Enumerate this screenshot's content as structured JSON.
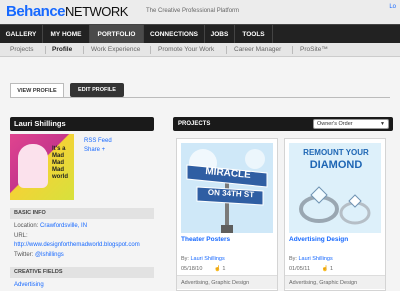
{
  "header": {
    "logo": "Behance",
    "logo_network": "NETWORK",
    "tagline": "The Creative Professional Platform",
    "top_right": "Lo"
  },
  "main_nav": [
    {
      "label": "GALLERY"
    },
    {
      "label": "MY HOME"
    },
    {
      "label": "PORTFOLIO"
    },
    {
      "label": "CONNECTIONS"
    },
    {
      "label": "JOBS"
    },
    {
      "label": "TOOLS"
    }
  ],
  "sub_nav": [
    {
      "label": "Projects"
    },
    {
      "label": "Profile"
    },
    {
      "label": "Work Experience"
    },
    {
      "label": "Promote Your Work"
    },
    {
      "label": "Career Manager"
    },
    {
      "label": "ProSite™"
    }
  ],
  "profile_tabs": {
    "view": "VIEW PROFILE",
    "edit": "EDIT PROFILE"
  },
  "profile": {
    "name": "Lauri Shillings",
    "avatar_text": "It's a Mad Mad Mad world",
    "rss": "RSS Feed",
    "share": "Share +"
  },
  "basic_info": {
    "heading": "BASIC INFO",
    "location_label": "Location:",
    "location": "Crawfordsville, IN",
    "url_label": "URL:",
    "url": "http://www.designforthemadworld.blogspot.com",
    "twitter_label": "Twitter:",
    "twitter": "@lshillings"
  },
  "creative_fields": {
    "heading": "CREATIVE FIELDS",
    "first": "Advertising"
  },
  "projects": {
    "heading": "PROJECTS",
    "order": "Owner's Order",
    "items": [
      {
        "title": "Theater Posters",
        "by": "By:",
        "author": "Lauri Shillings",
        "date": "05/18/10",
        "count": "1",
        "categories": "Advertising, Graphic Design",
        "art_line1": "MIRACLE",
        "art_line2": "ON 34TH ST"
      },
      {
        "title": "Advertising Design",
        "by": "By:",
        "author": "Lauri Shillings",
        "date": "01/05/11",
        "count": "1",
        "categories": "Advertising, Graphic Design",
        "art_line1": "REMOUNT YOUR",
        "art_line2": "DIAMOND"
      }
    ]
  }
}
